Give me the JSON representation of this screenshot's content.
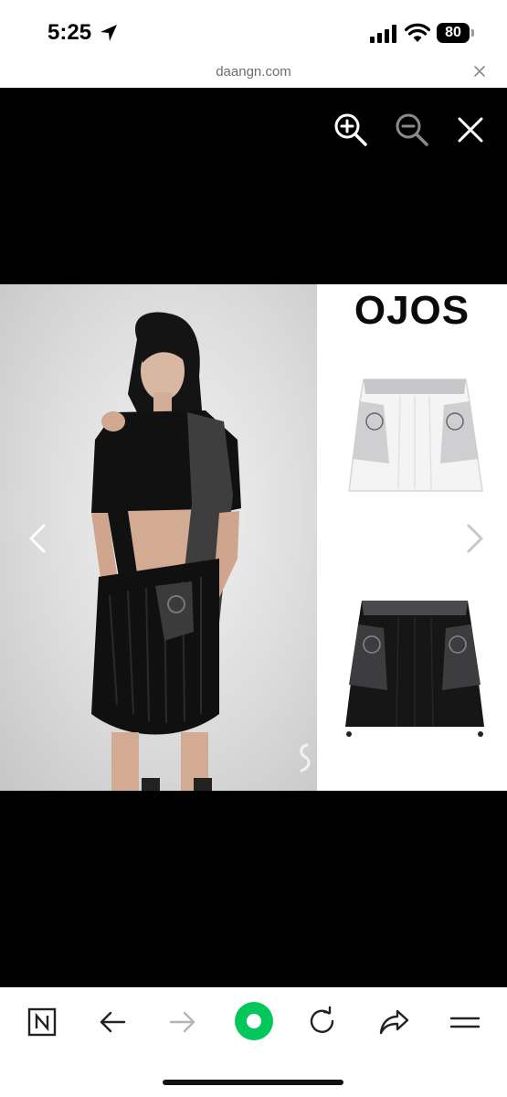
{
  "status_bar": {
    "time": "5:25",
    "battery_level": "80",
    "icons": [
      "location-arrow-icon",
      "cellular-signal-icon",
      "wifi-icon",
      "battery-icon"
    ]
  },
  "url_bar": {
    "url": "daangn.com",
    "close_icon": "close-icon"
  },
  "viewer": {
    "background": "#000000",
    "controls": [
      "zoom-in-icon",
      "zoom-out-icon",
      "close-icon",
      "previous-arrow-icon",
      "next-arrow-icon"
    ],
    "image": {
      "brand_text": "OJOS"
    }
  },
  "toolbar": {
    "icons": [
      "naver-n-icon",
      "back-arrow-icon",
      "forward-arrow-icon",
      "green-dot-icon",
      "reload-icon",
      "share-icon",
      "menu-icon"
    ],
    "accent_color": "#03c75a"
  }
}
